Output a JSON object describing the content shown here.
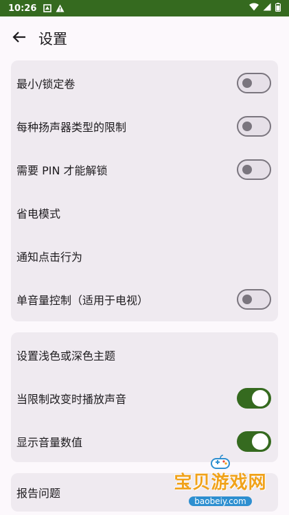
{
  "status_bar": {
    "time": "10:26",
    "colors": {
      "background": "#356a1f"
    }
  },
  "app_bar": {
    "title": "设置"
  },
  "sections": [
    {
      "rows": [
        {
          "label": "最小/锁定卷",
          "toggle": "off"
        },
        {
          "label": "每种扬声器类型的限制",
          "toggle": "off"
        },
        {
          "label": "需要 PIN 才能解锁",
          "toggle": "off"
        },
        {
          "label": "省电模式",
          "toggle": null
        },
        {
          "label": "通知点击行为",
          "toggle": null
        },
        {
          "label": "单音量控制（适用于电视）",
          "toggle": "off"
        }
      ]
    },
    {
      "rows": [
        {
          "label": "设置浅色或深色主题",
          "toggle": null
        },
        {
          "label": "当限制改变时播放声音",
          "toggle": "on"
        },
        {
          "label": "显示音量数值",
          "toggle": "on"
        }
      ]
    },
    {
      "rows": [
        {
          "label": "报告问题",
          "toggle": null
        }
      ]
    }
  ],
  "watermark": {
    "title": "宝贝游戏网",
    "url": "baobeiy.com"
  },
  "colors": {
    "accent": "#356a1f",
    "card": "#efeaf0",
    "background": "#fcf8fc"
  }
}
